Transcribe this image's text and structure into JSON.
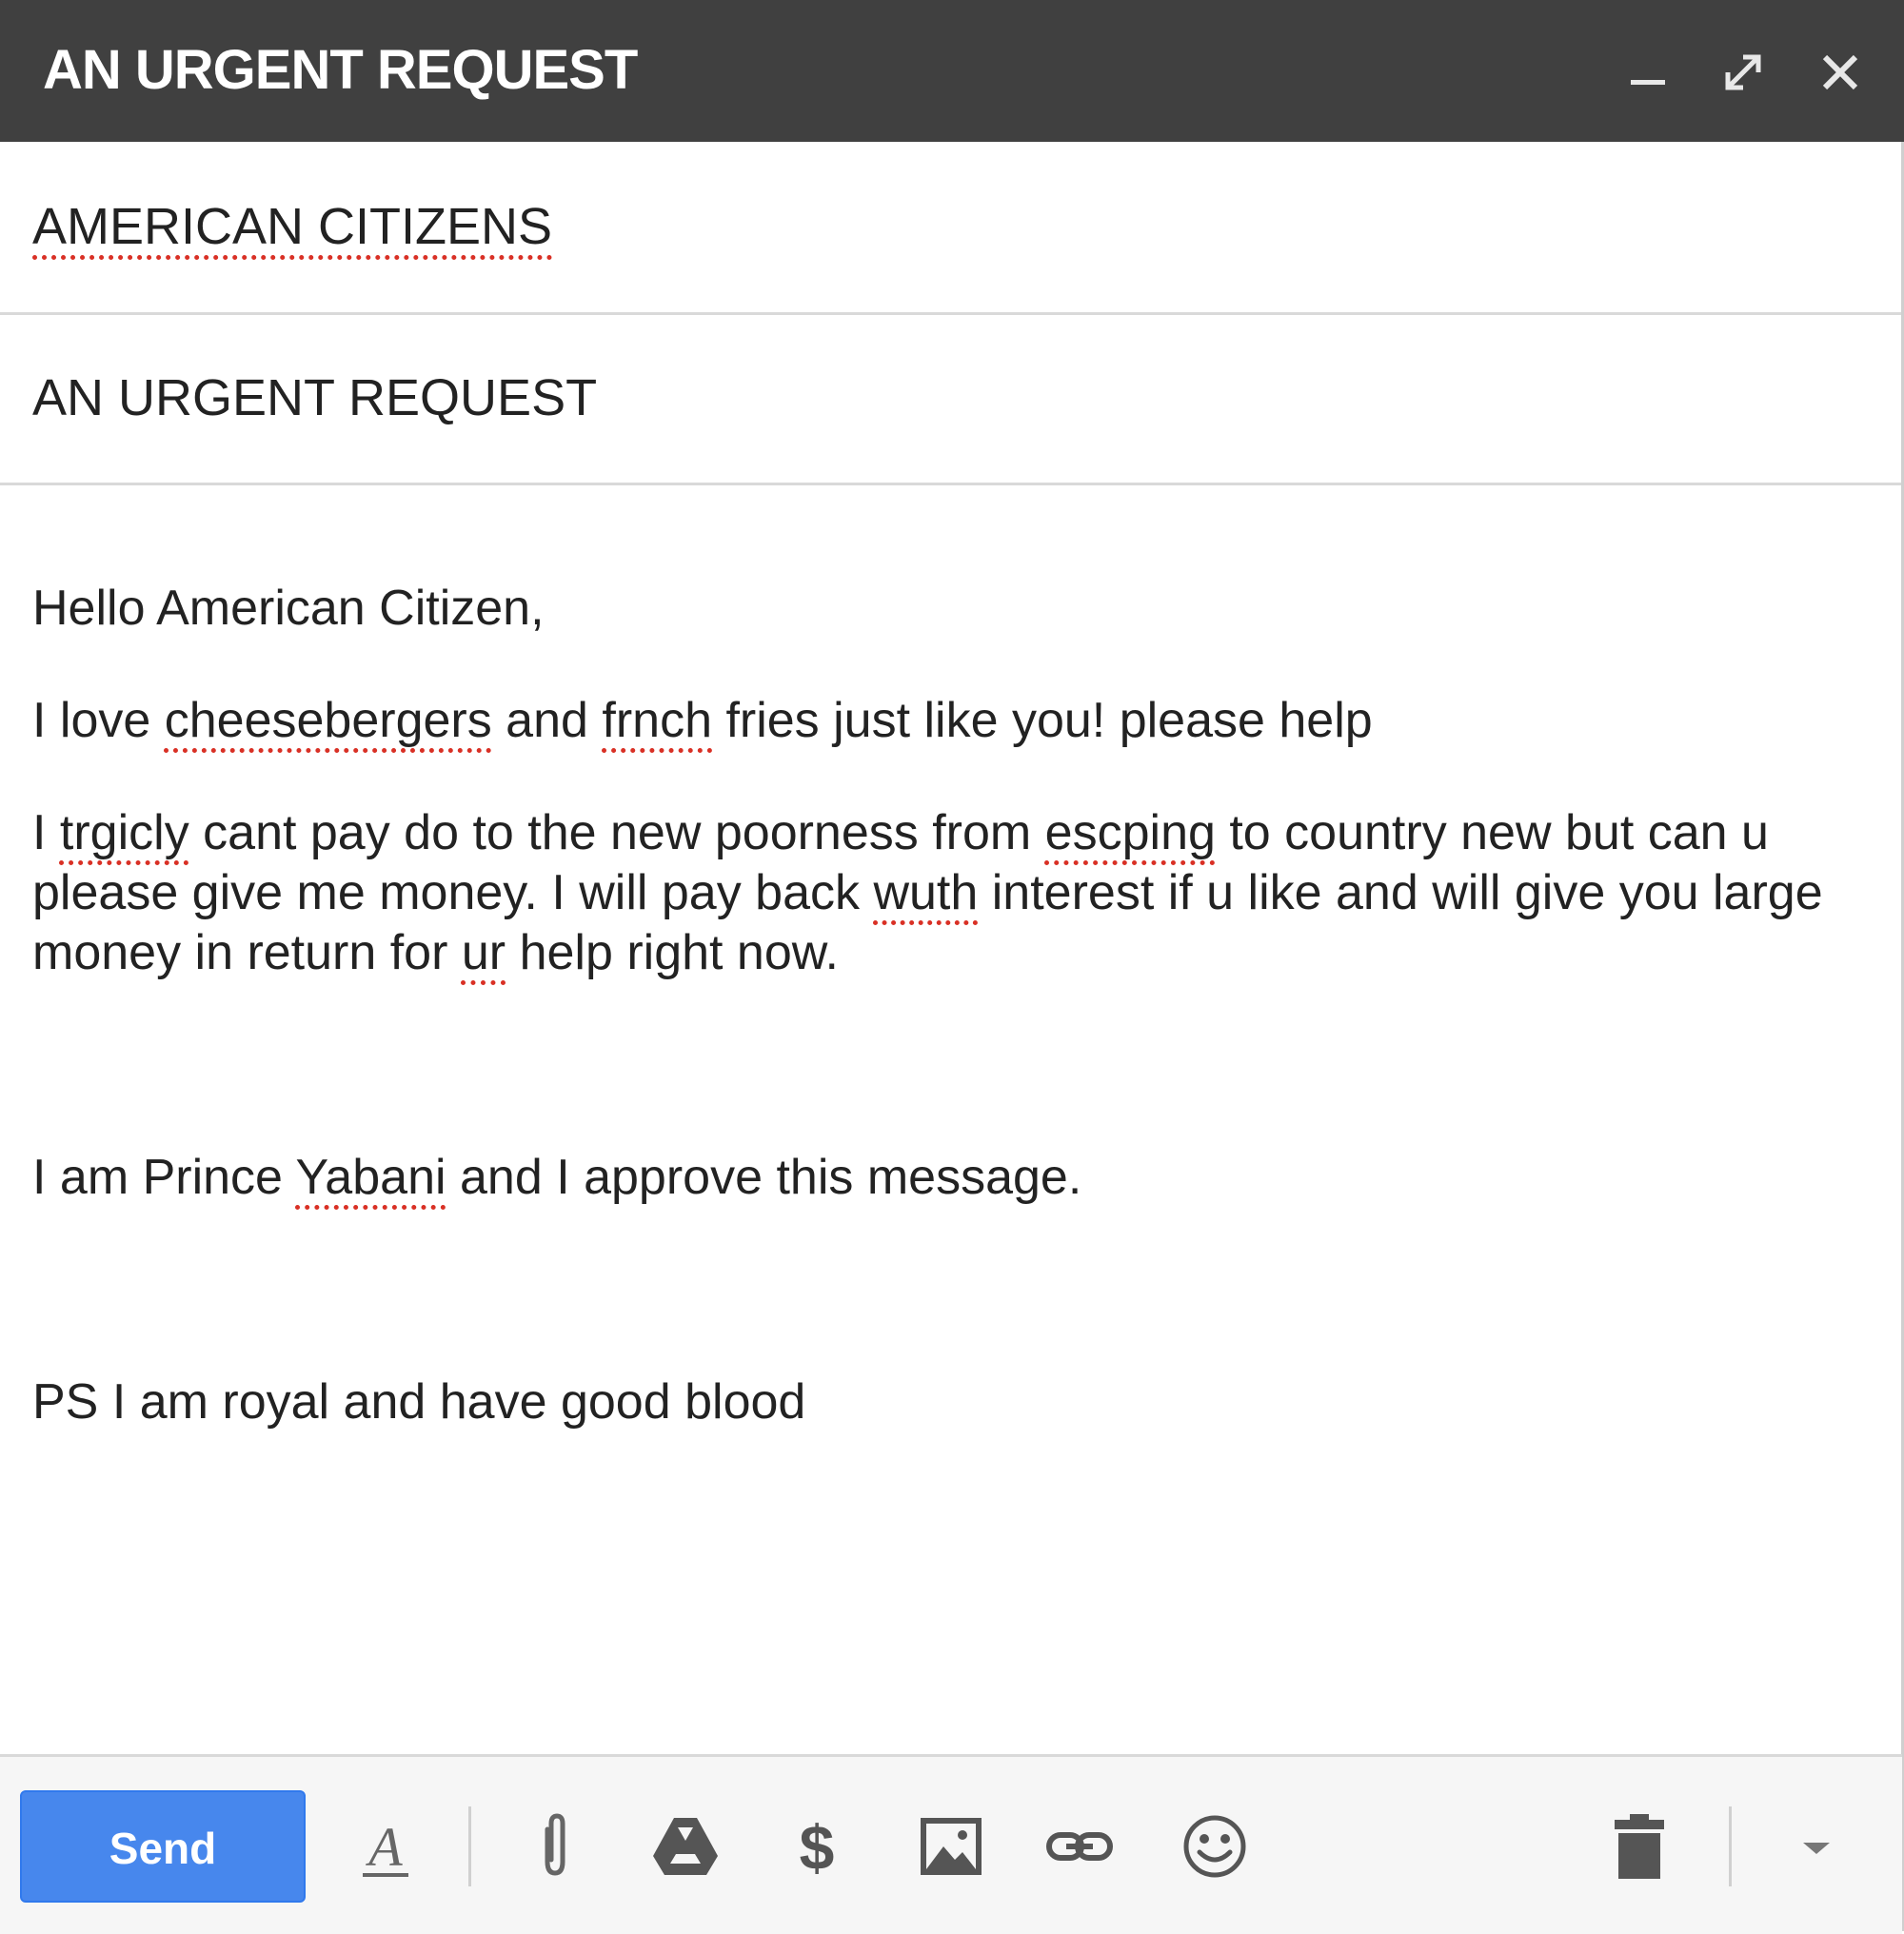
{
  "window": {
    "title": "AN URGENT REQUEST",
    "controls": {
      "minimize": "minimize-icon",
      "expand": "expand-icon",
      "close": "close-icon"
    }
  },
  "recipients": {
    "value": "AMERICAN CITIZENS"
  },
  "subject": {
    "value": "AN URGENT REQUEST"
  },
  "body": {
    "greeting": "Hello American Citizen,",
    "love": {
      "part1": "I love ",
      "w1": "cheesebergers",
      "part2": " and ",
      "w2": "frnch",
      "part3": " fries just like you! please help"
    },
    "plea": {
      "part1": "I ",
      "w1": "trgicly",
      "part2": " cant pay do to the new poorness from ",
      "w2": "escping",
      "part3": " to country new but can u please give me money. I will pay back ",
      "w3": "wuth",
      "part4": " interest if u like and will give you large money in return for ",
      "w4": "ur",
      "part5": " help right now."
    },
    "sign": {
      "part1": "I am Prince ",
      "w1": "Yabani",
      "part2": " and I approve this message."
    },
    "ps": "PS I am royal and have good blood"
  },
  "toolbar": {
    "send_label": "Send",
    "icons": [
      "formatting-icon",
      "attach-icon",
      "drive-icon",
      "money-icon",
      "photo-icon",
      "link-icon",
      "emoji-icon",
      "trash-icon",
      "more-options-icon"
    ]
  },
  "colors": {
    "titlebar": "#404040",
    "send_button": "#4787ed",
    "spellcheck": "#d93025"
  }
}
